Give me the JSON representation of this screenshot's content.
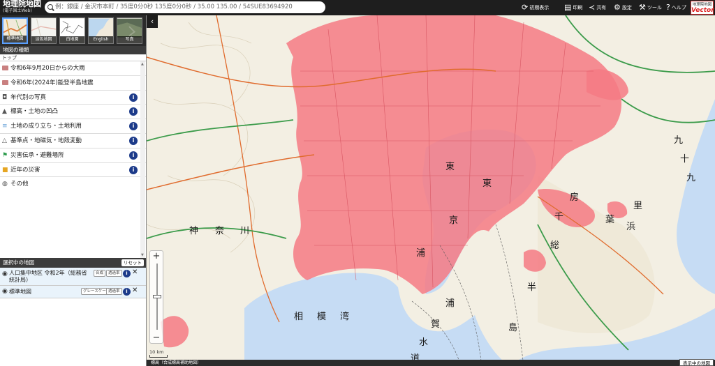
{
  "header": {
    "title": "地理院地図",
    "subtitle": "(電子国土Web)",
    "search_placeholder": "例：銀座 / 金沢市本町 / 35度0分0秒 135度0分0秒 / 35.00 135.00 / 54SUE83694920",
    "buttons": [
      {
        "icon": "reload-icon",
        "label": "初期表示"
      },
      {
        "icon": "print-icon",
        "label": "印刷"
      },
      {
        "icon": "share-icon",
        "label": "共有"
      },
      {
        "icon": "gear-icon",
        "label": "設定"
      },
      {
        "icon": "tool-icon",
        "label": "ツール"
      },
      {
        "icon": "help-icon",
        "label": "ヘルプ"
      }
    ],
    "vector_badge": {
      "top": "地理院地図",
      "bottom": "Vector"
    }
  },
  "basemaps": [
    {
      "label": "標準地図",
      "selected": true
    },
    {
      "label": "淡色地図",
      "selected": false
    },
    {
      "label": "白地図",
      "selected": false
    },
    {
      "label": "English",
      "selected": false
    },
    {
      "label": "写真",
      "selected": false
    }
  ],
  "map_types": {
    "header": "地図の種類",
    "breadcrumb": "トップ",
    "items": [
      {
        "label": "令和6年9月20日からの大雨",
        "icon": "folder-icon",
        "info": false
      },
      {
        "label": "令和6年(2024年)能登半島地震",
        "icon": "folder-icon",
        "info": false
      },
      {
        "label": "年代別の写真",
        "icon": "camera-icon",
        "info": true
      },
      {
        "label": "標高・土地の凹凸",
        "icon": "mountain-icon",
        "info": true
      },
      {
        "label": "土地の成り立ち・土地利用",
        "icon": "landuse-icon",
        "info": true
      },
      {
        "label": "基準点・地磁気・地殻変動",
        "icon": "triangle-point-icon",
        "info": true
      },
      {
        "label": "災害伝承・避難場所",
        "icon": "evacuation-icon",
        "info": true
      },
      {
        "label": "近年の災害",
        "icon": "disaster-icon",
        "info": true
      },
      {
        "label": "その他",
        "icon": "globe-icon",
        "info": false
      }
    ]
  },
  "selected_maps": {
    "header": "選択中の地図",
    "reset_label": "リセット",
    "layers": [
      {
        "name": "人口集中地区 令和2年（総務省統計局）",
        "buttons": [
          "合成",
          "透過率"
        ]
      },
      {
        "name": "標準地図",
        "buttons": [
          "グレースケール",
          "透過率"
        ]
      }
    ]
  },
  "map": {
    "scale_label": "10 km",
    "center_info": "標高（合成標高補助地図）",
    "display_button": "表示中の地図",
    "labels": [
      "神",
      "奈",
      "川",
      "相",
      "模",
      "湾",
      "東",
      "京",
      "千",
      "葉",
      "浦",
      "賀",
      "水",
      "道",
      "房",
      "総",
      "半",
      "島",
      "九",
      "十",
      "九",
      "里",
      "浜"
    ]
  },
  "colors": {
    "did_fill": "#f47a84",
    "water": "#c6dcf4",
    "land": "#f3efe3",
    "topbar": "#1e1e1e",
    "info": "#1d3b8a"
  }
}
